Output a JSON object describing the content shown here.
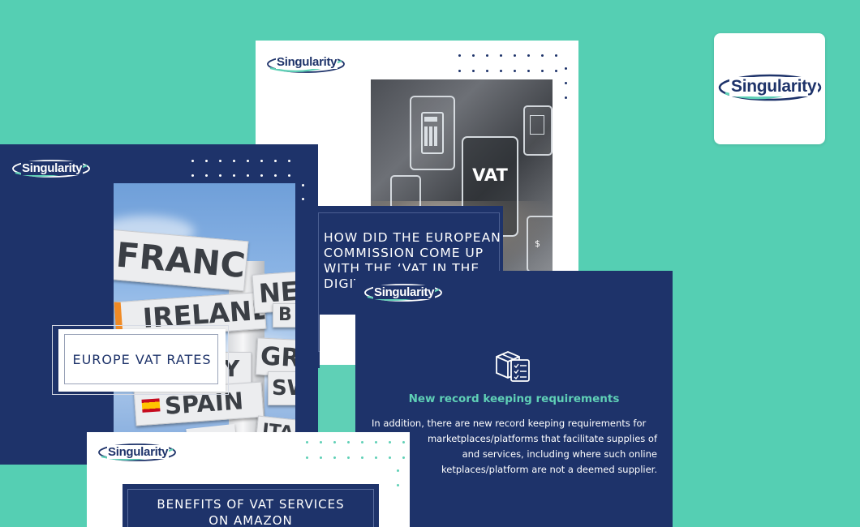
{
  "brand": {
    "name": "Singularity"
  },
  "colors": {
    "background": "#55cfb3",
    "navy": "#1e336a",
    "teal": "#5fd0b6",
    "white": "#ffffff"
  },
  "cards": {
    "logo_tile": {
      "logo": "Singularity"
    },
    "vat_digital": {
      "logo": "Singularity",
      "image_label": "VAT",
      "title_line1": "HOW DID THE EUROPEAN",
      "title_line2": "COMMISSION COME UP",
      "title_line3": "WITH THE ‘VAT IN THE",
      "title_line4": "DIGIT"
    },
    "europe_rates": {
      "logo": "Singularity",
      "title": "EUROPE VAT RATES",
      "signs": [
        "FRANCE",
        "IRELAND",
        "SPAIN",
        "NETH",
        "GRE",
        "SW",
        "ITALY",
        "B",
        "Y"
      ]
    },
    "record_keeping": {
      "logo": "Singularity",
      "icon": "package-checklist-icon",
      "title": "New record keeping requirements",
      "body_line1": "In addition, there are new record keeping requirements for",
      "body_line2": "marketplaces/platforms that facilitate supplies of",
      "body_line3": "and services, including where such online",
      "body_line4": "ketplaces/platform are not a deemed supplier."
    },
    "amazon_benefits": {
      "logo": "Singularity",
      "title_line1": "BENEFITS OF VAT SERVICES",
      "title_line2": "ON AMAZON"
    }
  }
}
